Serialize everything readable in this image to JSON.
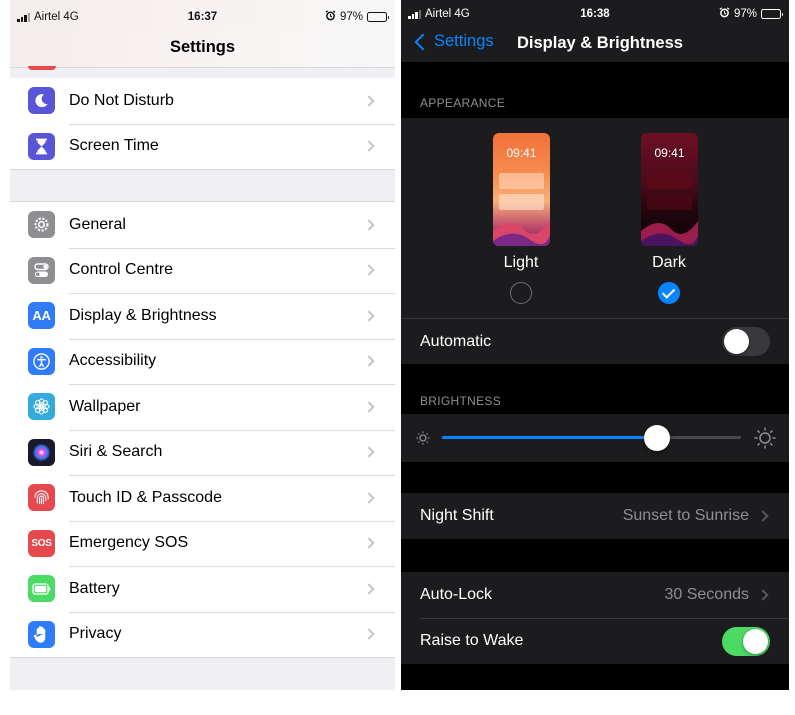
{
  "left": {
    "status": {
      "carrier": "Airtel 4G",
      "time": "16:37",
      "battery": "97%"
    },
    "title": "Settings",
    "group1": [
      {
        "label": "Do Not Disturb",
        "icon": "moon-icon",
        "color": "#5856d6"
      },
      {
        "label": "Screen Time",
        "icon": "hourglass-icon",
        "color": "#5856d6"
      }
    ],
    "group2": [
      {
        "label": "General",
        "icon": "gear-icon",
        "color": "#8e8e93"
      },
      {
        "label": "Control Centre",
        "icon": "switches-icon",
        "color": "#8e8e93"
      },
      {
        "label": "Display & Brightness",
        "icon": "text-size-icon",
        "icon_text": "AA",
        "color": "#2f7cf6"
      },
      {
        "label": "Accessibility",
        "icon": "accessibility-icon",
        "color": "#2f7cf6"
      },
      {
        "label": "Wallpaper",
        "icon": "flower-icon",
        "color": "#35aadc"
      },
      {
        "label": "Siri & Search",
        "icon": "siri-icon",
        "color": "#1a1a2e"
      },
      {
        "label": "Touch ID & Passcode",
        "icon": "fingerprint-icon",
        "color": "#e5484d"
      },
      {
        "label": "Emergency SOS",
        "icon": "sos-icon",
        "icon_text": "SOS",
        "color": "#e5484d"
      },
      {
        "label": "Battery",
        "icon": "battery-icon",
        "color": "#4cd964"
      },
      {
        "label": "Privacy",
        "icon": "hand-icon",
        "color": "#2f7cf6"
      }
    ]
  },
  "right": {
    "status": {
      "carrier": "Airtel 4G",
      "time": "16:38",
      "battery": "97%"
    },
    "back_label": "Settings",
    "title": "Display & Brightness",
    "appearance": {
      "header": "APPEARANCE",
      "light": {
        "label": "Light",
        "time": "09:41",
        "selected": false
      },
      "dark": {
        "label": "Dark",
        "time": "09:41",
        "selected": true
      },
      "automatic_label": "Automatic",
      "automatic_on": false
    },
    "brightness": {
      "header": "BRIGHTNESS",
      "level": 0.72
    },
    "night_shift": {
      "label": "Night Shift",
      "value": "Sunset to Sunrise"
    },
    "auto_lock": {
      "label": "Auto-Lock",
      "value": "30 Seconds"
    },
    "raise_to_wake": {
      "label": "Raise to Wake",
      "on": true
    },
    "accent": "#0a84ff"
  }
}
